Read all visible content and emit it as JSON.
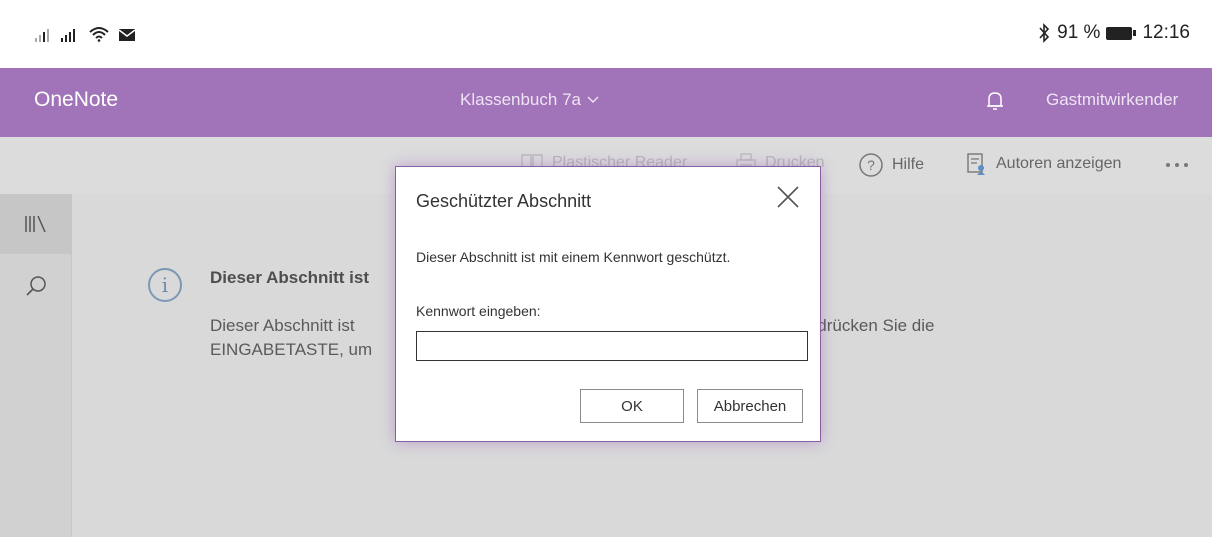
{
  "status_bar": {
    "battery_percent": "91 %",
    "time": "12:16",
    "icons": [
      "signal-icon",
      "signal-icon",
      "wifi-icon",
      "mail-icon",
      "bluetooth-icon",
      "battery-icon"
    ]
  },
  "app_bar": {
    "app_name": "OneNote",
    "notebook_name": "Klassenbuch 7a",
    "user_label": "Gastmitwirkender",
    "background_color": "#a173b8"
  },
  "toolbar": {
    "immersive_reader_label": "Plastischer Reader",
    "print_label": "Drucken",
    "help_label": "Hilfe",
    "show_authors_label": "Autoren anzeigen"
  },
  "content": {
    "message_title": "Dieser Abschnitt ist",
    "message_line1": "Dieser Abschnitt ist",
    "message_line1_end": "oder drücken Sie die",
    "message_line2": "EINGABETASTE, um"
  },
  "dialog": {
    "title": "Geschützter Abschnitt",
    "description": "Dieser Abschnitt ist mit einem Kennwort geschützt.",
    "password_label": "Kennwort eingeben:",
    "password_value": "",
    "ok_label": "OK",
    "cancel_label": "Abbrechen",
    "accent_color": "#8a5ea3"
  }
}
